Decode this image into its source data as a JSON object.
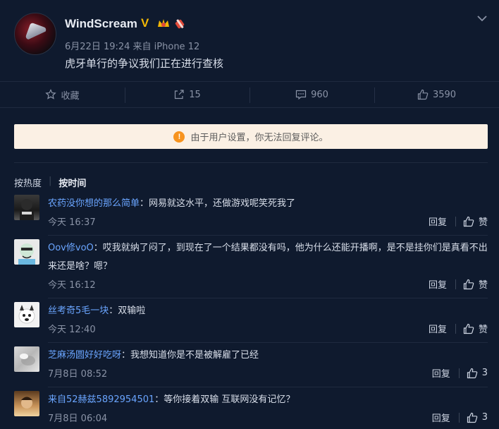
{
  "post": {
    "username": "WindScream",
    "meta": "6月22日 19:24 来自 iPhone 12",
    "text": "虎牙单行的争议我们正在进行查核"
  },
  "actions": {
    "favorite": "收藏",
    "repost": "15",
    "comment": "960",
    "like": "3590"
  },
  "notice": "由于用户设置，你无法回复评论。",
  "sort": {
    "by_heat": "按热度",
    "by_time": "按时间"
  },
  "comments": [
    {
      "name": "农药没你想的那么简单",
      "text": "：网易就这水平，还做游戏呢笑死我了",
      "time": "今天 16:37",
      "reply": "回复",
      "like": "赞"
    },
    {
      "name": "Oov修voO",
      "text": "：哎我就纳了闷了，到现在了一个结果都没有吗，他为什么还能开播啊，是不是挂你们是真看不出来还是啥？嗯？",
      "time": "今天 16:12",
      "reply": "回复",
      "like": "赞"
    },
    {
      "name": "丝考奇5毛一块",
      "text": "：双输啦",
      "time": "今天 12:40",
      "reply": "回复",
      "like": "赞"
    },
    {
      "name": "芝麻汤圆好好吃呀",
      "text": "：我想知道你是不是被解雇了已经",
      "time": "7月8日 08:52",
      "reply": "回复",
      "like": "3"
    },
    {
      "name": "来自52赫兹5892954501",
      "text": "：等你接着双输 互联网没有记忆？",
      "time": "7月8日 06:04",
      "reply": "回复",
      "like": "3"
    }
  ],
  "colors": {
    "background": "#0f1a2e",
    "link": "#6aa5ff",
    "notice_bg": "#fbf0e4",
    "warning": "#f7931e",
    "verified": "#f2b705"
  }
}
